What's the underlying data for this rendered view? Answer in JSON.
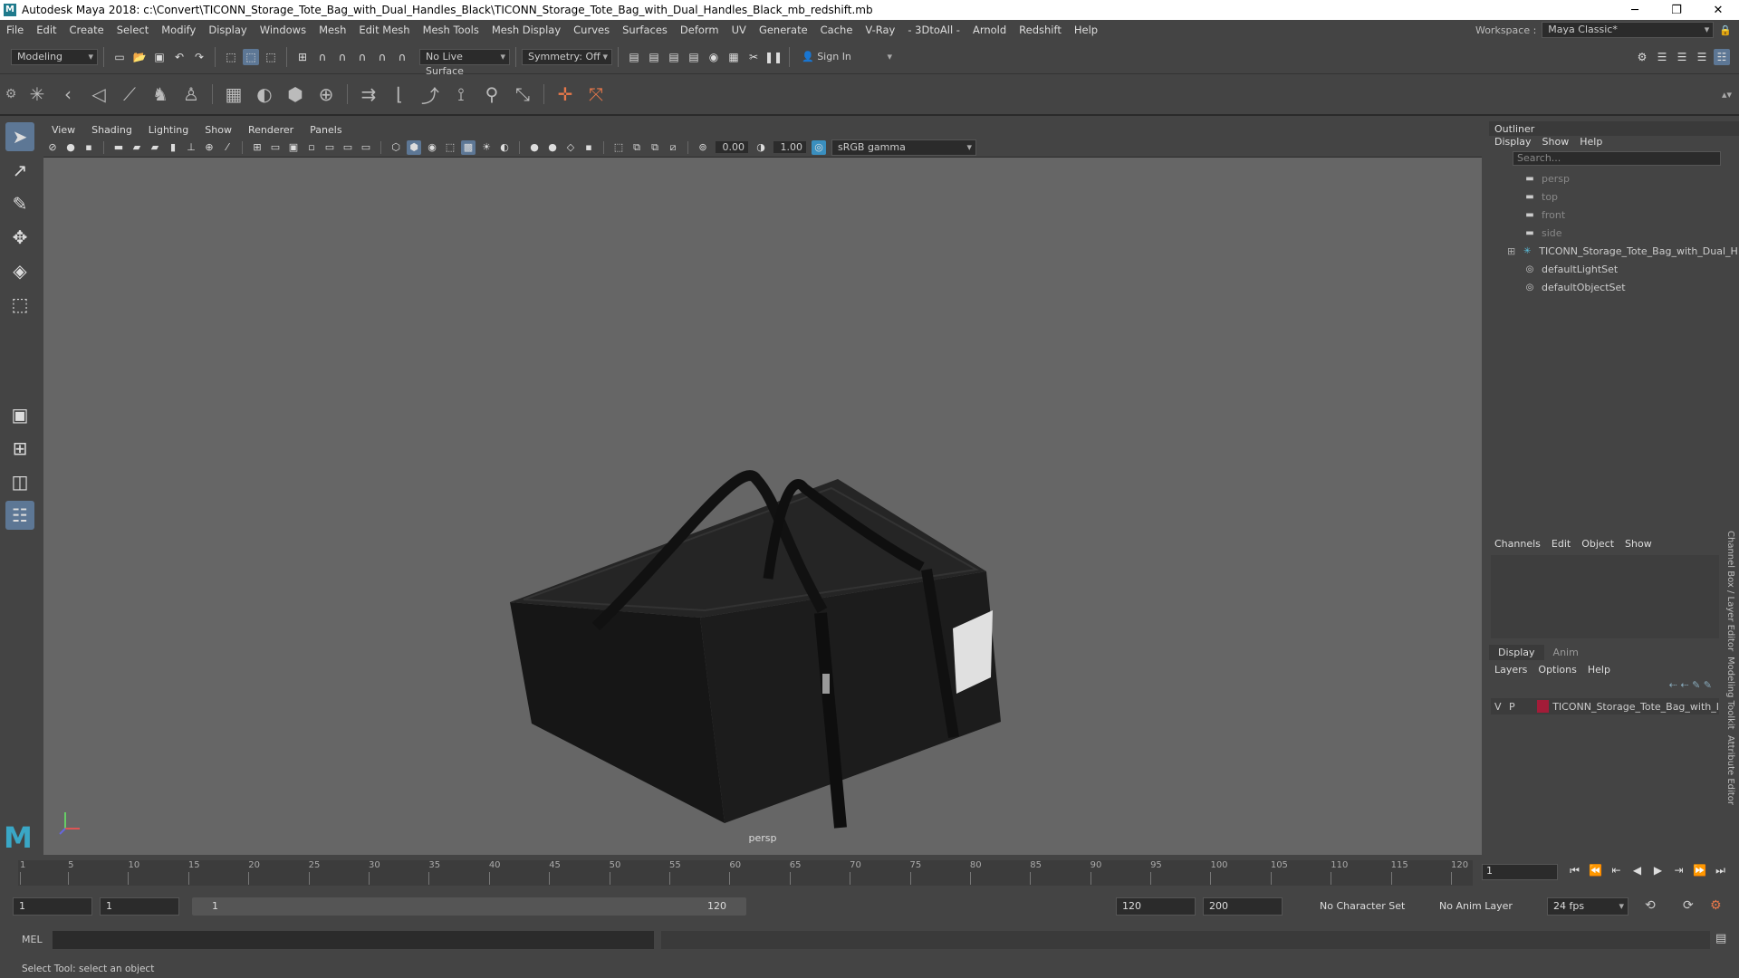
{
  "titlebar": {
    "title": "Autodesk Maya 2018: c:\\Convert\\TICONN_Storage_Tote_Bag_with_Dual_Handles_Black\\TICONN_Storage_Tote_Bag_with_Dual_Handles_Black_mb_redshift.mb",
    "logo": "M"
  },
  "menus": [
    "File",
    "Edit",
    "Create",
    "Select",
    "Modify",
    "Display",
    "Windows",
    "Mesh",
    "Edit Mesh",
    "Mesh Tools",
    "Mesh Display",
    "Curves",
    "Surfaces",
    "Deform",
    "UV",
    "Generate",
    "Cache",
    "V-Ray",
    "- 3DtoAll -",
    "Arnold",
    "Redshift",
    "Help"
  ],
  "workspace": {
    "label": "Workspace :",
    "value": "Maya Classic*"
  },
  "statusline": {
    "mode": "Modeling",
    "live_surface": "No Live Surface",
    "symmetry": "Symmetry: Off",
    "signin": "Sign In"
  },
  "viewport": {
    "menus": [
      "View",
      "Shading",
      "Lighting",
      "Show",
      "Renderer",
      "Panels"
    ],
    "exposure": "0.00",
    "gamma": "1.00",
    "colorspace": "sRGB gamma",
    "camera": "persp"
  },
  "outliner": {
    "title": "Outliner",
    "menus": [
      "Display",
      "Show",
      "Help"
    ],
    "search_placeholder": "Search...",
    "items": [
      {
        "label": "persp",
        "icon": "camera-icon",
        "dim": true
      },
      {
        "label": "top",
        "icon": "camera-icon",
        "dim": true
      },
      {
        "label": "front",
        "icon": "camera-icon",
        "dim": true
      },
      {
        "label": "side",
        "icon": "camera-icon",
        "dim": true
      },
      {
        "label": "TICONN_Storage_Tote_Bag_with_Dual_H",
        "icon": "group-icon",
        "dim": false,
        "expand": "⊞"
      },
      {
        "label": "defaultLightSet",
        "icon": "set-icon",
        "dim": false
      },
      {
        "label": "defaultObjectSet",
        "icon": "set-icon",
        "dim": false
      }
    ]
  },
  "channelbox": {
    "menus": [
      "Channels",
      "Edit",
      "Object",
      "Show"
    ]
  },
  "layers": {
    "tabs": [
      "Display",
      "Anim"
    ],
    "menus": [
      "Layers",
      "Options",
      "Help"
    ],
    "row": {
      "v": "V",
      "p": "P",
      "name": "TICONN_Storage_Tote_Bag_with_I",
      "color": "#a21c38"
    }
  },
  "sidetabs": [
    "Channel Box / Layer Editor",
    "Modeling Toolkit",
    "Attribute Editor"
  ],
  "timeline": {
    "ticks": [
      "1",
      "5",
      "10",
      "15",
      "20",
      "25",
      "30",
      "35",
      "40",
      "45",
      "50",
      "55",
      "60",
      "65",
      "70",
      "75",
      "80",
      "85",
      "90",
      "95",
      "100",
      "105",
      "110",
      "115",
      "120"
    ],
    "current_frame": "1"
  },
  "range": {
    "start": "1",
    "start2": "1",
    "slider_start": "1",
    "slider_end": "120",
    "end": "120",
    "end2": "200",
    "charset": "No Character Set",
    "animlayer": "No Anim Layer",
    "fps": "24 fps"
  },
  "mel": {
    "label": "MEL"
  },
  "helpline": "Select Tool: select an object"
}
